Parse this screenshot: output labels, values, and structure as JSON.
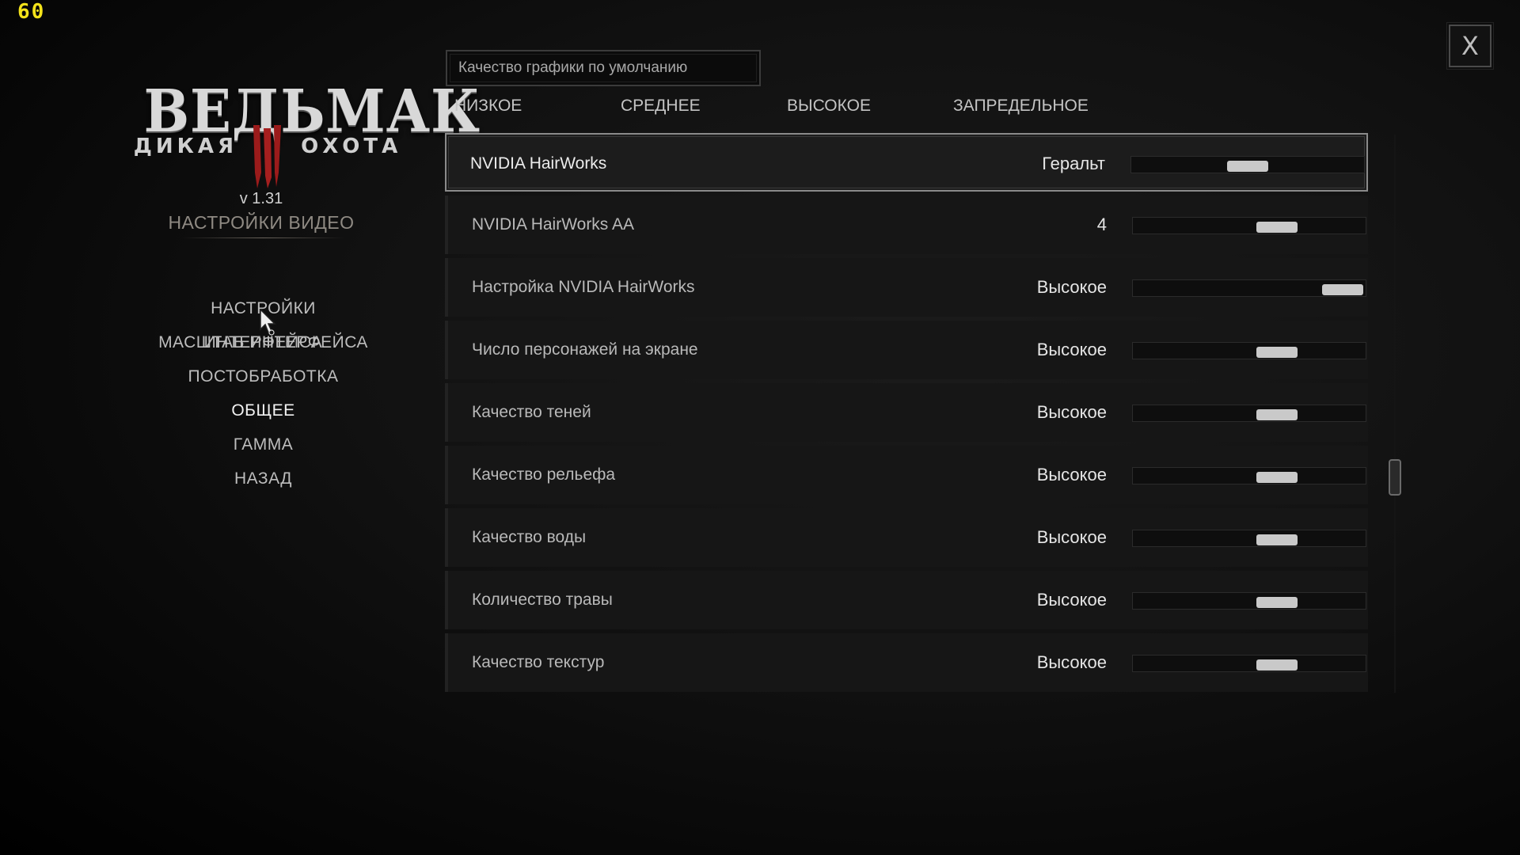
{
  "fps": "60",
  "close_label": "X",
  "logo": {
    "title": "ВЕДЬМАК",
    "subtitle_left": "ДИКАЯ",
    "subtitle_right": "ОХОТА"
  },
  "version": "v 1.31",
  "section_title": "НАСТРОЙКИ ВИДЕО",
  "menu": {
    "items": [
      {
        "label": "НАСТРОЙКИ ИНТЕРФЕЙСА",
        "active": false
      },
      {
        "label": "МАСШТАБ ИНТЕРФЕЙСА",
        "active": false
      },
      {
        "label": "ПОСТОБРАБОТКА",
        "active": false
      },
      {
        "label": "ОБЩЕЕ",
        "active": true
      },
      {
        "label": "ГАММА",
        "active": false
      },
      {
        "label": "НАЗАД",
        "active": false
      }
    ]
  },
  "preset": {
    "current": "Качество графики по умолчанию",
    "options": [
      "НИЗКОЕ",
      "СРЕДНЕЕ",
      "ВЫСОКОЕ",
      "ЗАПРЕДЕЛЬНОЕ"
    ]
  },
  "settings": [
    {
      "label": "NVIDIA HairWorks",
      "value": "Геральт",
      "slider_fraction": 0.5,
      "selected": true
    },
    {
      "label": "NVIDIA HairWorks AA",
      "value": "4",
      "slider_fraction": 0.62,
      "selected": false
    },
    {
      "label": "Настройка NVIDIA HairWorks",
      "value": "Высокое",
      "slider_fraction": 0.9,
      "selected": false
    },
    {
      "label": "Число персонажей на экране",
      "value": "Высокое",
      "slider_fraction": 0.62,
      "selected": false
    },
    {
      "label": "Качество теней",
      "value": "Высокое",
      "slider_fraction": 0.62,
      "selected": false
    },
    {
      "label": "Качество рельефа",
      "value": "Высокое",
      "slider_fraction": 0.62,
      "selected": false
    },
    {
      "label": "Качество воды",
      "value": "Высокое",
      "slider_fraction": 0.62,
      "selected": false
    },
    {
      "label": "Количество травы",
      "value": "Высокое",
      "slider_fraction": 0.62,
      "selected": false
    },
    {
      "label": "Качество текстур",
      "value": "Высокое",
      "slider_fraction": 0.62,
      "selected": false
    }
  ],
  "colors": {
    "fps": "#f3e21a",
    "accent_red": "#9b1b1b"
  }
}
